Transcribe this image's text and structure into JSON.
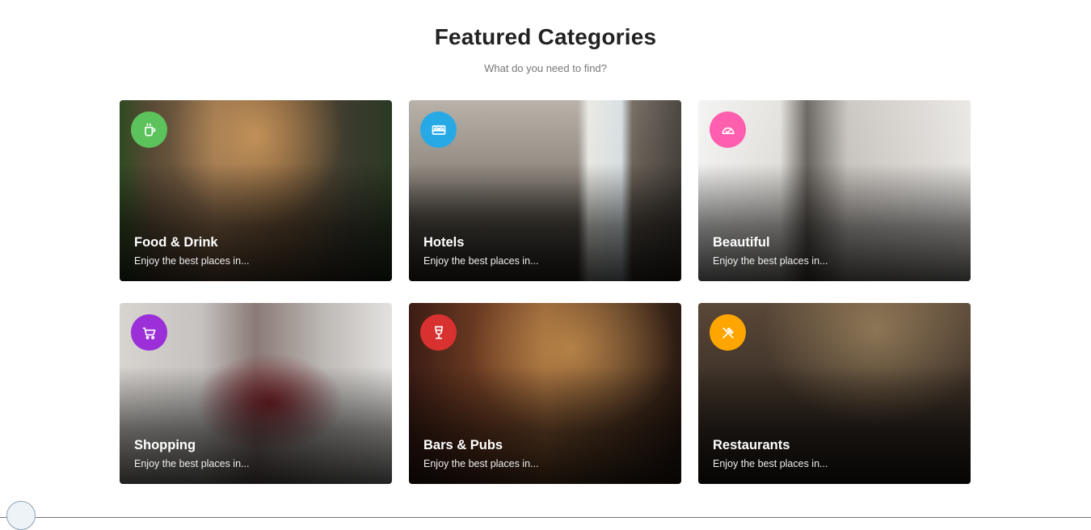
{
  "header": {
    "title": "Featured Categories",
    "subtitle": "What do you need to find?"
  },
  "categories": [
    {
      "name": "Food & Drink",
      "desc": "Enjoy the best places in...",
      "icon": "coffee-cup-icon",
      "color": "#5cc25c"
    },
    {
      "name": "Hotels",
      "desc": "Enjoy the best places in...",
      "icon": "bed-icon",
      "color": "#27a9e6"
    },
    {
      "name": "Beautiful",
      "desc": "Enjoy the best places in...",
      "icon": "spa-icon",
      "color": "#ff5fae"
    },
    {
      "name": "Shopping",
      "desc": "Enjoy the best places in...",
      "icon": "shopping-cart-icon",
      "color": "#9b30d9"
    },
    {
      "name": "Bars & Pubs",
      "desc": "Enjoy the best places in...",
      "icon": "wine-glass-icon",
      "color": "#d93030"
    },
    {
      "name": "Restaurants",
      "desc": "Enjoy the best places in...",
      "icon": "fork-knife-icon",
      "color": "#ffa500"
    }
  ]
}
